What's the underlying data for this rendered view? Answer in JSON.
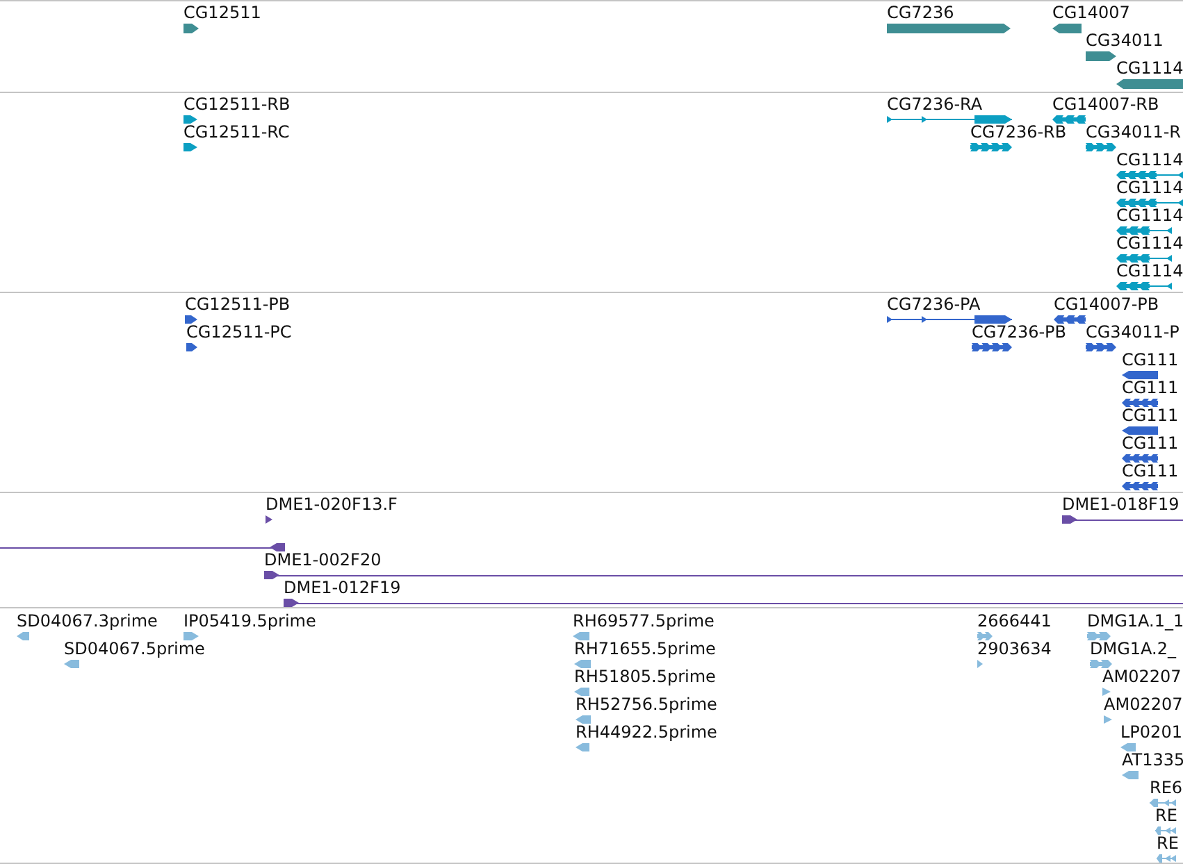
{
  "tracks": [
    {
      "kind": "gene",
      "color": "#3f8e93",
      "features": [
        {
          "label": "CG12511",
          "reverse": false
        },
        {
          "label": "CG7236",
          "reverse": false
        },
        {
          "label": "CG14007",
          "reverse": true
        },
        {
          "label": "CG34011",
          "reverse": false
        },
        {
          "label": "CG1114",
          "reverse": true
        }
      ]
    },
    {
      "kind": "transcript",
      "color": "#0c9fc2",
      "features": [
        {
          "label": "CG12511-RB",
          "reverse": false
        },
        {
          "label": "CG7236-RA",
          "reverse": false
        },
        {
          "label": "CG14007-RB",
          "reverse": true
        },
        {
          "label": "CG12511-RC",
          "reverse": false
        },
        {
          "label": "CG7236-RB",
          "reverse": false
        },
        {
          "label": "CG34011-R",
          "reverse": false
        },
        {
          "label": "CG1114",
          "reverse": true
        },
        {
          "label": "CG1114",
          "reverse": true
        },
        {
          "label": "CG1114",
          "reverse": true
        },
        {
          "label": "CG1114",
          "reverse": true
        },
        {
          "label": "CG1114",
          "reverse": true
        }
      ]
    },
    {
      "kind": "protein",
      "color": "#3366cc",
      "features": [
        {
          "label": "CG12511-PB",
          "reverse": false
        },
        {
          "label": "CG7236-PA",
          "reverse": false
        },
        {
          "label": "CG14007-PB",
          "reverse": true
        },
        {
          "label": "CG12511-PC",
          "reverse": false
        },
        {
          "label": "CG7236-PB",
          "reverse": false
        },
        {
          "label": "CG34011-P",
          "reverse": false
        },
        {
          "label": "CG111",
          "reverse": true
        },
        {
          "label": "CG111",
          "reverse": true
        },
        {
          "label": "CG111",
          "reverse": true
        },
        {
          "label": "CG111",
          "reverse": true
        },
        {
          "label": "CG111",
          "reverse": true
        }
      ]
    },
    {
      "kind": "clone",
      "color": "#6a4ea6",
      "features": [
        {
          "label": "DME1-020F13.F",
          "reverse": false
        },
        {
          "label": "DME1-018F19",
          "reverse": false
        },
        {
          "reverse": true
        },
        {
          "label": "DME1-002F20",
          "reverse": false
        },
        {
          "label": "DME1-012F19",
          "reverse": false
        }
      ]
    },
    {
      "kind": "est",
      "color": "#88bbdd",
      "features": [
        {
          "label": "SD04067.3prime",
          "reverse": true
        },
        {
          "label": "IP05419.5prime",
          "reverse": false
        },
        {
          "label": "RH69577.5prime",
          "reverse": true
        },
        {
          "label": "2666441",
          "reverse": false
        },
        {
          "label": "DMG1A.1_1",
          "reverse": false
        },
        {
          "label": "SD04067.5prime",
          "reverse": true
        },
        {
          "label": "RH71655.5prime",
          "reverse": true
        },
        {
          "label": "2903634",
          "reverse": false
        },
        {
          "label": "DMG1A.2_",
          "reverse": false
        },
        {
          "label": "RH51805.5prime",
          "reverse": true
        },
        {
          "label": "AM02207",
          "reverse": false
        },
        {
          "label": "RH52756.5prime",
          "reverse": true
        },
        {
          "label": "AM02207",
          "reverse": false
        },
        {
          "label": "RH44922.5prime",
          "reverse": true
        },
        {
          "label": "LP0201",
          "reverse": true
        },
        {
          "label": "AT1335",
          "reverse": true
        },
        {
          "label": "RE6",
          "reverse": true
        },
        {
          "label": "RE",
          "reverse": true
        },
        {
          "label": "RE",
          "reverse": true
        }
      ]
    }
  ]
}
